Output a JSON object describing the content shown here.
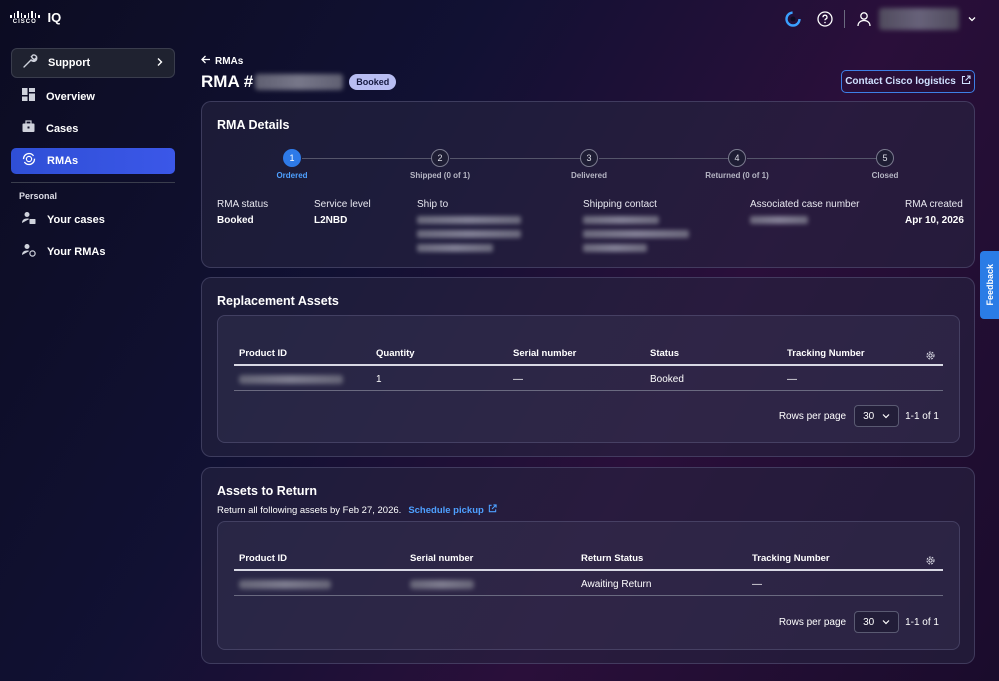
{
  "app": {
    "brand_word": "CISCO",
    "brand_product": "IQ"
  },
  "sidebar": {
    "support_label": "Support",
    "items": [
      {
        "label": "Overview"
      },
      {
        "label": "Cases"
      },
      {
        "label": "RMAs"
      }
    ],
    "section_label": "Personal",
    "personal_items": [
      {
        "label": "Your cases"
      },
      {
        "label": "Your RMAs"
      }
    ]
  },
  "header": {
    "back_label": "RMAs",
    "title_prefix": "RMA #",
    "status_badge": "Booked",
    "contact_button": "Contact Cisco logistics"
  },
  "rma_details": {
    "title": "RMA Details",
    "steps": [
      {
        "num": "1",
        "label": "Ordered",
        "active": true
      },
      {
        "num": "2",
        "label": "Shipped (0 of 1)"
      },
      {
        "num": "3",
        "label": "Delivered"
      },
      {
        "num": "4",
        "label": "Returned (0 of 1)"
      },
      {
        "num": "5",
        "label": "Closed"
      }
    ],
    "fields": {
      "rma_status_label": "RMA status",
      "rma_status_value": "Booked",
      "service_level_label": "Service level",
      "service_level_value": "L2NBD",
      "ship_to_label": "Ship to",
      "shipping_contact_label": "Shipping contact",
      "case_number_label": "Associated case number",
      "rma_created_label": "RMA created",
      "rma_created_value": "Apr 10, 2026"
    }
  },
  "replacement_assets": {
    "title": "Replacement Assets",
    "columns": [
      "Product ID",
      "Quantity",
      "Serial number",
      "Status",
      "Tracking Number"
    ],
    "rows": [
      {
        "quantity": "1",
        "serial": "—",
        "status": "Booked",
        "tracking": "—"
      }
    ],
    "rows_per_page_label": "Rows per page",
    "rows_per_page_value": "30",
    "range": "1-1 of 1"
  },
  "assets_to_return": {
    "title": "Assets to Return",
    "note": "Return all following assets by Feb 27, 2026.",
    "schedule_link": "Schedule pickup",
    "columns": [
      "Product ID",
      "Serial number",
      "Return Status",
      "Tracking Number"
    ],
    "rows": [
      {
        "return_status": "Awaiting Return",
        "tracking": "—"
      }
    ],
    "rows_per_page_label": "Rows per page",
    "rows_per_page_value": "30",
    "range": "1-1 of 1"
  },
  "feedback_tab": "Feedback",
  "colors": {
    "accent": "#2f4fd6",
    "link": "#4ea0ff",
    "badge": "#b8bdf2",
    "feedback": "#2a7ce6"
  }
}
